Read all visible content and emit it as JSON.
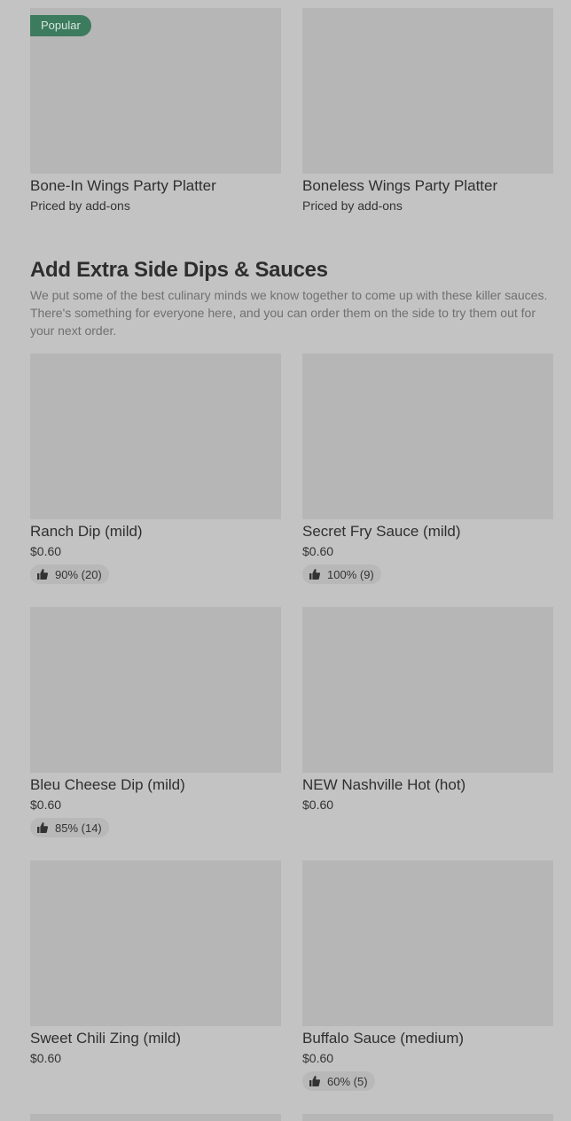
{
  "platters": [
    {
      "name": "Bone-In Wings Party Platter",
      "price": "Priced by add-ons",
      "badge": "Popular"
    },
    {
      "name": "Boneless Wings Party Platter",
      "price": "Priced by add-ons"
    }
  ],
  "section": {
    "title": "Add Extra Side Dips & Sauces",
    "description": "We put some of the best culinary minds we know together to come up with these killer sauces. There's something for everyone here, and you can order them on the side to try them out for your next order."
  },
  "items": [
    {
      "name": "Ranch Dip (mild)",
      "price": "$0.60",
      "rating": "90% (20)"
    },
    {
      "name": "Secret Fry Sauce (mild)",
      "price": "$0.60",
      "rating": "100% (9)"
    },
    {
      "name": "Bleu Cheese Dip (mild)",
      "price": "$0.60",
      "rating": "85% (14)"
    },
    {
      "name": "NEW Nashville Hot (hot)",
      "price": "$0.60"
    },
    {
      "name": "Sweet Chili Zing (mild)",
      "price": "$0.60"
    },
    {
      "name": "Buffalo Sauce (medium)",
      "price": "$0.60",
      "rating": "60% (5)"
    }
  ],
  "icons": {
    "rating": "thumbs-up-icon"
  },
  "colors": {
    "background": "#c3c3c3",
    "image_placeholder": "#b6b6b6",
    "badge": "#3c7b5e",
    "rating_pill": "#b8b8b8"
  }
}
